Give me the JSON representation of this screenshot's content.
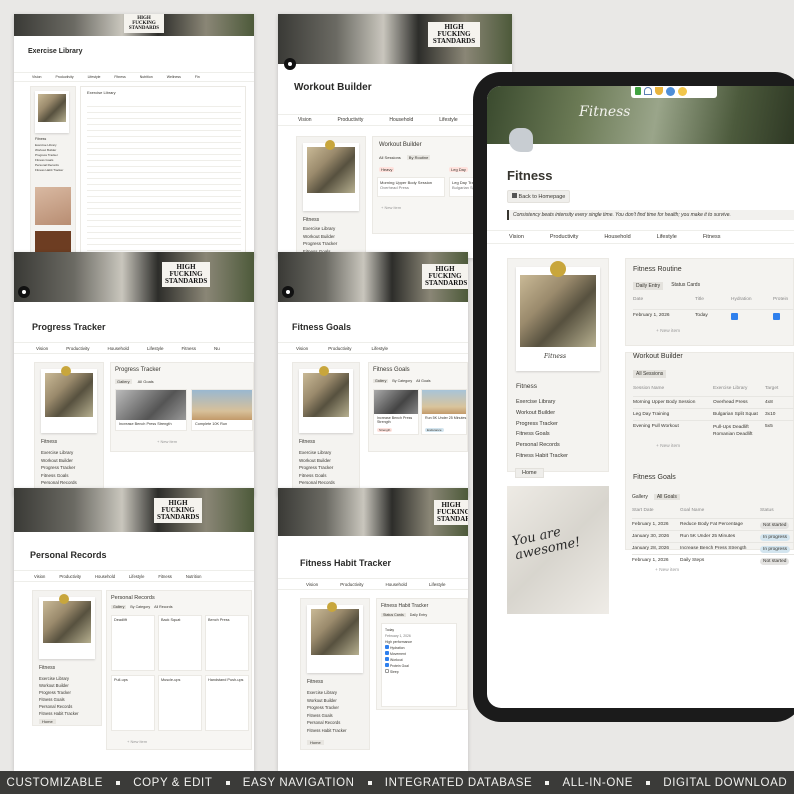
{
  "slogan": "HIGH\nFUCKING\nSTANDARDS",
  "exercise_library": {
    "title": "Exercise Library",
    "nav": [
      "Vision",
      "Productivity",
      "Lifestyle",
      "Fitness",
      "Nutrition",
      "Wellness",
      "Fin"
    ],
    "db_title": "Exercise Library",
    "side_items": [
      "Exercise Library",
      "Workout Builder",
      "Progress Tracker",
      "Fitness Goals",
      "Personal Records",
      "Fitness Habit Tracker"
    ],
    "side_label": "Fitness"
  },
  "workout_builder_page": {
    "title": "Workout Builder",
    "nav": [
      "Vision",
      "Productivity",
      "Household",
      "Lifestyle"
    ],
    "db_title": "Workout Builder",
    "tabs": [
      "All Sessions",
      "By Routine"
    ],
    "groups": [
      "Heavy",
      "Leg Day"
    ],
    "card1": "Morning Upper Body Session",
    "card1_sub": "Overhead Press",
    "card2": "Leg Day Training",
    "card2_sub": "Bulgarian Split",
    "add": "+ New item",
    "side_label": "Fitness",
    "side_items": [
      "Exercise Library",
      "Workout Builder",
      "Progress Tracker",
      "Fitness Goals",
      "Personal Records"
    ]
  },
  "progress_tracker": {
    "title": "Progress Tracker",
    "nav": [
      "Vision",
      "Productivity",
      "Household",
      "Lifestyle",
      "Fitness",
      "Nu"
    ],
    "db_title": "Progress Tracker",
    "tabs": [
      "Gallery",
      "All Goals"
    ],
    "card1": "Increase Bench Press Strength",
    "card2": "Complete 10K Run",
    "add": "+ New item",
    "side_label": "Fitness",
    "side_items": [
      "Exercise Library",
      "Workout Builder",
      "Progress Tracker",
      "Fitness Goals",
      "Personal Records"
    ]
  },
  "fitness_goals_page": {
    "title": "Fitness Goals",
    "nav": [
      "Vision",
      "Productivity",
      "Lifestyle"
    ],
    "db_title": "Fitness Goals",
    "tabs": [
      "Gallery",
      "By Category",
      "All Goals"
    ],
    "card1": "Increase Bench Press Strength",
    "card1_tag": "Strength",
    "card2": "Run 5K Under 25 Minutes",
    "card2_tag": "Endurance",
    "side_label": "Fitness",
    "side_items": [
      "Exercise Library",
      "Workout Builder",
      "Progress Tracker",
      "Fitness Goals",
      "Personal Records"
    ]
  },
  "personal_records": {
    "title": "Personal Records",
    "nav": [
      "Vision",
      "Productivity",
      "Household",
      "Lifestyle",
      "Fitness",
      "Nutrition"
    ],
    "db_title": "Personal Records",
    "tabs": [
      "Gallery",
      "By Category",
      "All Records"
    ],
    "records": [
      "Deadlift",
      "Back Squat",
      "Bench Press",
      "Pull-ups",
      "Muscle-ups",
      "Handstand Push-ups"
    ],
    "add": "+ New item",
    "home": "Home",
    "side_label": "Fitness",
    "side_items": [
      "Exercise Library",
      "Workout Builder",
      "Progress Tracker",
      "Fitness Goals",
      "Personal Records",
      "Fitness Habit Tracker"
    ]
  },
  "habit_tracker": {
    "title": "Fitness Habit Tracker",
    "nav": [
      "Vision",
      "Productivity",
      "Household",
      "Lifestyle"
    ],
    "db_title": "Fitness Habit Tracker",
    "tabs": [
      "Status Cards",
      "Daily Entry"
    ],
    "card_date": "February 1, 2026",
    "card_title": "Today",
    "card_status": "High performance",
    "checks": [
      "Hydration",
      "Movement",
      "Workout",
      "Protein Goal",
      "Sleep"
    ],
    "home": "Home",
    "side_label": "Fitness",
    "side_items": [
      "Exercise Library",
      "Workout Builder",
      "Progress Tracker",
      "Fitness Goals",
      "Personal Records",
      "Fitness Habit Tracker"
    ]
  },
  "tablet": {
    "cover_script": "Fitness",
    "title": "Fitness",
    "back_button": "Back to Homepage",
    "quote": "Consistency beats intensity every single time. You don't find time for health; you make it to survive.",
    "nav": [
      "Vision",
      "Productivity",
      "Household",
      "Lifestyle",
      "Fitness"
    ],
    "polaroid_caption": "Fitness",
    "side_label": "Fitness",
    "side_items": [
      "Exercise Library",
      "Workout Builder",
      "Progress Tracker",
      "Fitness Goals",
      "Personal Records",
      "Fitness Habit Tracker"
    ],
    "home": "Home",
    "note_text": "You are awesome!",
    "routine": {
      "title": "Fitness Routine",
      "tabs": [
        "Daily Entry",
        "Status Cards"
      ],
      "cols": [
        "Date",
        "Title",
        "Hydration",
        "Protein"
      ],
      "row_date": "February 1, 2026",
      "row_title": "Today",
      "new": "+ New item"
    },
    "builder": {
      "title": "Workout Builder",
      "tab": "All Sessions",
      "cols": [
        "Session Name",
        "Exercise Library",
        "Target"
      ],
      "rows": [
        {
          "name": "Morning Upper Body Session",
          "ex": "Overhead Press",
          "target": "4x8"
        },
        {
          "name": "Leg Day Training",
          "ex": "Bulgarian Split Squat",
          "target": "3x10"
        },
        {
          "name": "Evening Pull Workout",
          "ex": "Pull-Ups",
          "ex2": "Deadlift",
          "ex3": "Romanian Deadlift",
          "target": "5x5"
        }
      ],
      "new": "+ New item"
    },
    "goals": {
      "title": "Fitness Goals",
      "tabs": [
        "Gallery",
        "All Goals"
      ],
      "cols": [
        "Start Date",
        "Goal Name",
        "Status"
      ],
      "rows": [
        {
          "date": "February 1, 2026",
          "name": "Reduce Body Fat Percentage",
          "status": "Not started"
        },
        {
          "date": "January 30, 2026",
          "name": "Run 5K Under 25 Minutes",
          "status": "In progress"
        },
        {
          "date": "January 28, 2026",
          "name": "Increase Bench Press Strength",
          "status": "In progress"
        },
        {
          "date": "February 1, 2026",
          "name": "Daily Steps",
          "status": "Not started"
        }
      ],
      "new": "+ New item"
    }
  },
  "banner": [
    "CUSTOMIZABLE",
    "COPY & EDIT",
    "EASY NAVIGATION",
    "INTEGRATED DATABASE",
    "ALL-IN-ONE",
    "DIGITAL DOWNLOAD"
  ],
  "colors": {
    "banner_bg": "#3b3b39",
    "card_bg": "#f4f3f0",
    "in_progress": "#d3e5ef",
    "not_started": "#e3e2e0",
    "pin_gold": "#c8a63c",
    "tag_red": "#ffe2dd",
    "tag_blue": "#d3e5ef"
  }
}
